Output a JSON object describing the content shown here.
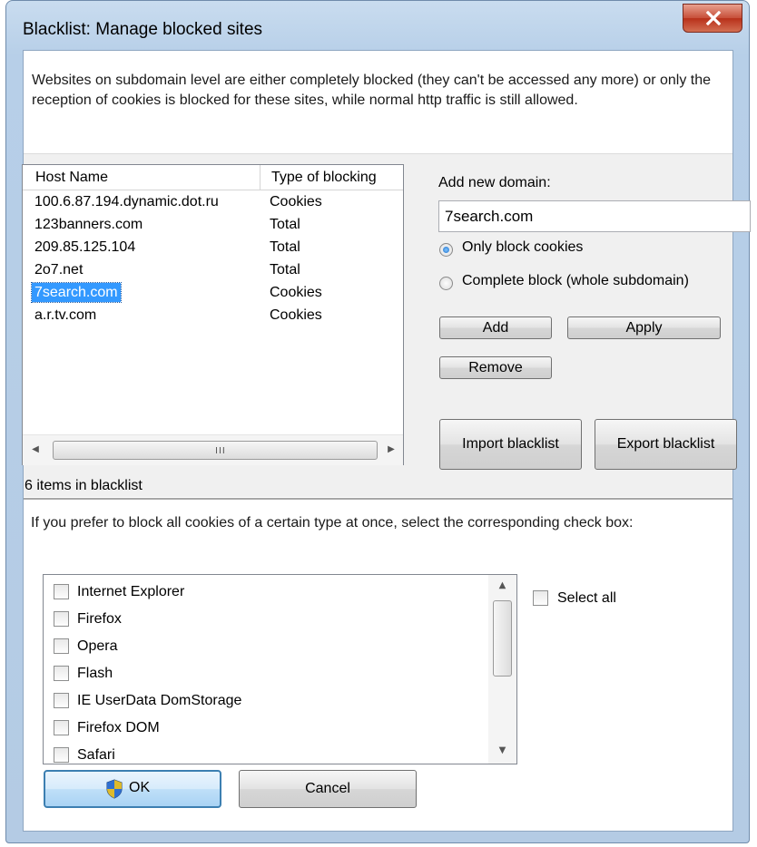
{
  "window": {
    "title": "Blacklist: Manage blocked sites"
  },
  "intro_text": "Websites on subdomain level are either completely blocked (they can't be accessed any more) or only the reception of cookies is blocked for these sites, while normal http traffic is still allowed.",
  "blocked_list": {
    "columns": [
      "Host Name",
      "Type of blocking"
    ],
    "rows": [
      {
        "host": "100.6.87.194.dynamic.dot.ru",
        "type": "Cookies"
      },
      {
        "host": "123banners.com",
        "type": "Total"
      },
      {
        "host": "209.85.125.104",
        "type": "Total"
      },
      {
        "host": "2o7.net",
        "type": "Total"
      },
      {
        "host": "7search.com",
        "type": "Cookies",
        "selected": true
      },
      {
        "host": "a.r.tv.com",
        "type": "Cookies"
      }
    ],
    "count_label": "6 items in blacklist"
  },
  "add_domain": {
    "label": "Add new domain:",
    "value": "7search.com",
    "option_cookies": "Only block cookies",
    "option_complete": "Complete block (whole subdomain)",
    "selected_option": "cookies",
    "add_label": "Add",
    "apply_label": "Apply",
    "remove_label": "Remove"
  },
  "import_label": "Import blacklist",
  "export_label": "Export blacklist",
  "cookie_types": {
    "description": "If you prefer to block all cookies of a certain type at once, select the corresponding check box:",
    "items": [
      {
        "label": "Internet Explorer",
        "checked": false
      },
      {
        "label": "Firefox",
        "checked": false
      },
      {
        "label": "Opera",
        "checked": false
      },
      {
        "label": "Flash",
        "checked": false
      },
      {
        "label": "IE UserData DomStorage",
        "checked": false
      },
      {
        "label": "Firefox DOM",
        "checked": false
      },
      {
        "label": "Safari",
        "checked": false
      }
    ],
    "select_all_label": "Select all"
  },
  "footer": {
    "ok_label": "OK",
    "cancel_label": "Cancel"
  }
}
